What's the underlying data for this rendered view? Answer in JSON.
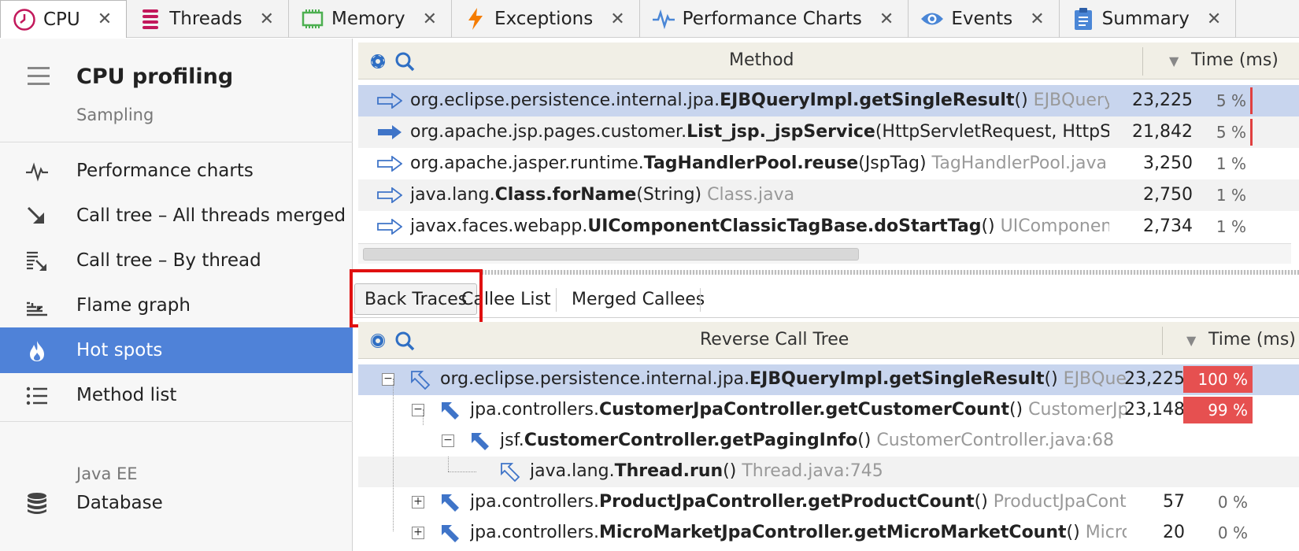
{
  "tabs": [
    {
      "label": "CPU",
      "icon": "clock-icon",
      "color": "#c2185b",
      "active": true
    },
    {
      "label": "Threads",
      "icon": "threads-icon",
      "color": "#c2185b"
    },
    {
      "label": "Memory",
      "icon": "memory-chip-icon",
      "color": "#4caf50"
    },
    {
      "label": "Exceptions",
      "icon": "lightning-icon",
      "color": "#f57c00"
    },
    {
      "label": "Performance Charts",
      "icon": "pulse-icon",
      "color": "#4a86d6"
    },
    {
      "label": "Events",
      "icon": "eye-icon",
      "color": "#4a86d6"
    },
    {
      "label": "Summary",
      "icon": "clipboard-icon",
      "color": "#4a86d6"
    }
  ],
  "tab_close": "✕",
  "sidebar": {
    "title": "CPU profiling",
    "subtitle": "Sampling",
    "items": [
      {
        "label": "Performance charts",
        "icon": "pulse-icon"
      },
      {
        "label": "Call tree – All threads merged",
        "icon": "arrow-down-right-icon"
      },
      {
        "label": "Call tree – By thread",
        "icon": "call-tree-thread-icon"
      },
      {
        "label": "Flame graph",
        "icon": "flame-graph-icon"
      },
      {
        "label": "Hot spots",
        "icon": "fire-icon",
        "selected": true
      },
      {
        "label": "Method list",
        "icon": "list-icon"
      }
    ],
    "section": "Java EE",
    "section_items": [
      {
        "label": "Database",
        "icon": "database-icon"
      }
    ]
  },
  "hotspots": {
    "method_header": "Method",
    "time_header": "Time (ms)",
    "rows": [
      {
        "prefix": "org.eclipse.persistence.internal.jpa.",
        "bold": "EJBQueryImpl.getSingleResult",
        "args": "()",
        "source": " EJBQueryImpl.java",
        "time": "23,225",
        "pct": "5 %"
      },
      {
        "prefix": "org.apache.jsp.pages.customer.",
        "bold": "List_jsp._jspService",
        "args": "(HttpServletRequest, HttpServletResp",
        "source": "",
        "time": "21,842",
        "pct": "5 %"
      },
      {
        "prefix": "org.apache.jasper.runtime.",
        "bold": "TagHandlerPool.reuse",
        "args": "(JspTag)",
        "source": " TagHandlerPool.java",
        "time": "3,250",
        "pct": "1 %"
      },
      {
        "prefix": "java.lang.",
        "bold": "Class.forName",
        "args": "(String)",
        "source": " Class.java",
        "time": "2,750",
        "pct": "1 %"
      },
      {
        "prefix": "javax.faces.webapp.",
        "bold": "UIComponentClassicTagBase.doStartTag",
        "args": "()",
        "source": " UIComponentClassicTa",
        "time": "2,734",
        "pct": "1 %"
      }
    ]
  },
  "subtabs": [
    "Back Traces",
    "Callee List",
    "Merged Callees"
  ],
  "backtraces": {
    "tree_header": "Reverse Call Tree",
    "time_header": "Time (ms)",
    "rows": [
      {
        "prefix": "org.eclipse.persistence.internal.jpa.",
        "bold": "EJBQueryImpl.getSingleResult",
        "args": "()",
        "source": " EJBQueryImpl.jav",
        "time": "23,225",
        "pct": "100 %"
      },
      {
        "prefix": "jpa.controllers.",
        "bold": "CustomerJpaController.getCustomerCount",
        "args": "()",
        "source": " CustomerJpaContrc",
        "time": "23,148",
        "pct": "99 %"
      },
      {
        "prefix": "jsf.",
        "bold": "CustomerController.getPagingInfo",
        "args": "()",
        "source": " CustomerController.java:68",
        "time": "",
        "pct": ""
      },
      {
        "prefix": "java.lang.",
        "bold": "Thread.run",
        "args": "()",
        "source": " Thread.java:745",
        "time": "",
        "pct": ""
      },
      {
        "prefix": "jpa.controllers.",
        "bold": "ProductJpaController.getProductCount",
        "args": "()",
        "source": " ProductJpaController.ja",
        "time": "57",
        "pct": "0 %"
      },
      {
        "prefix": "jpa.controllers.",
        "bold": "MicroMarketJpaController.getMicroMarketCount",
        "args": "()",
        "source": " MicroMarke",
        "time": "20",
        "pct": "0 %"
      }
    ]
  }
}
